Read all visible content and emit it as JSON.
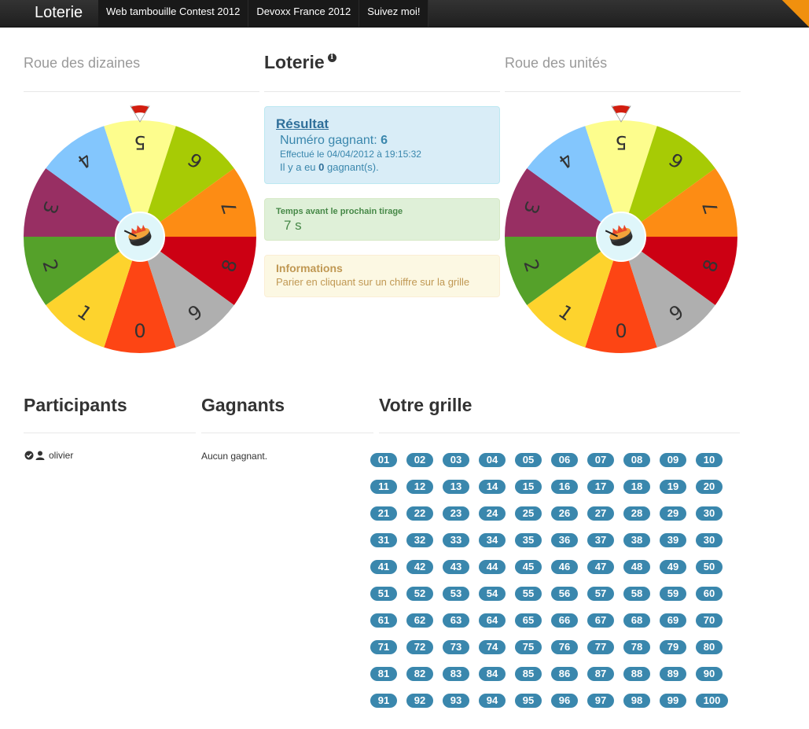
{
  "navbar": {
    "brand": "Loterie",
    "items": [
      "Web tambouille Contest 2012",
      "Devoxx France 2012",
      "Suivez moi!"
    ]
  },
  "left_wheel": {
    "title": "Roue des dizaines",
    "segments": [
      "0",
      "1",
      "2",
      "3",
      "4",
      "5",
      "6",
      "7",
      "8",
      "9"
    ],
    "colors": [
      "#fd4514",
      "#fdd32d",
      "#55a12a",
      "#982f63",
      "#83c6fd",
      "#fdfd8d",
      "#a7cb05",
      "#fd8c14",
      "#cc0013",
      "#afafaf"
    ]
  },
  "right_wheel": {
    "title": "Roue des unités",
    "segments": [
      "0",
      "1",
      "2",
      "3",
      "4",
      "5",
      "6",
      "7",
      "8",
      "9"
    ],
    "colors": [
      "#fd4514",
      "#fdd32d",
      "#55a12a",
      "#982f63",
      "#83c6fd",
      "#fdfd8d",
      "#a7cb05",
      "#fd8c14",
      "#cc0013",
      "#afafaf"
    ]
  },
  "center": {
    "title": "Loterie",
    "info_icon": "info-icon",
    "result": {
      "title": "Résultat",
      "winning_label": "Numéro gagnant: ",
      "winning_number": "6",
      "done_text": "Effectué le 04/04/2012 à 19:15:32",
      "winners_prefix": "Il y a eu ",
      "winners_count": "0",
      "winners_suffix": " gagnant(s)."
    },
    "timer": {
      "label": "Temps avant le prochain tirage",
      "value": "7 s"
    },
    "info": {
      "title": "Informations",
      "text": "Parier en cliquant sur un chiffre sur la grille"
    }
  },
  "participants": {
    "title": "Participants",
    "items": [
      {
        "name": "olivier",
        "icons": [
          "check-circle-icon",
          "user-icon"
        ]
      }
    ]
  },
  "winners": {
    "title": "Gagnants",
    "empty_text": "Aucun gagnant."
  },
  "grid": {
    "title": "Votre grille",
    "rows": [
      [
        "01",
        "02",
        "03",
        "04",
        "05",
        "06",
        "07",
        "08",
        "09",
        "10"
      ],
      [
        "11",
        "12",
        "13",
        "14",
        "15",
        "16",
        "17",
        "18",
        "19",
        "20"
      ],
      [
        "21",
        "22",
        "23",
        "24",
        "25",
        "26",
        "27",
        "28",
        "29",
        "30"
      ],
      [
        "31",
        "32",
        "33",
        "34",
        "35",
        "36",
        "37",
        "38",
        "39",
        "30"
      ],
      [
        "41",
        "42",
        "43",
        "44",
        "45",
        "46",
        "47",
        "48",
        "49",
        "50"
      ],
      [
        "51",
        "52",
        "53",
        "54",
        "55",
        "56",
        "57",
        "58",
        "59",
        "60"
      ],
      [
        "61",
        "62",
        "63",
        "64",
        "65",
        "66",
        "67",
        "68",
        "69",
        "70"
      ],
      [
        "71",
        "72",
        "73",
        "74",
        "75",
        "76",
        "77",
        "78",
        "79",
        "80"
      ],
      [
        "81",
        "82",
        "83",
        "84",
        "85",
        "86",
        "87",
        "88",
        "89",
        "90"
      ],
      [
        "91",
        "92",
        "93",
        "94",
        "95",
        "96",
        "97",
        "98",
        "99",
        "100"
      ]
    ],
    "badge_color": "#3a87ad"
  }
}
